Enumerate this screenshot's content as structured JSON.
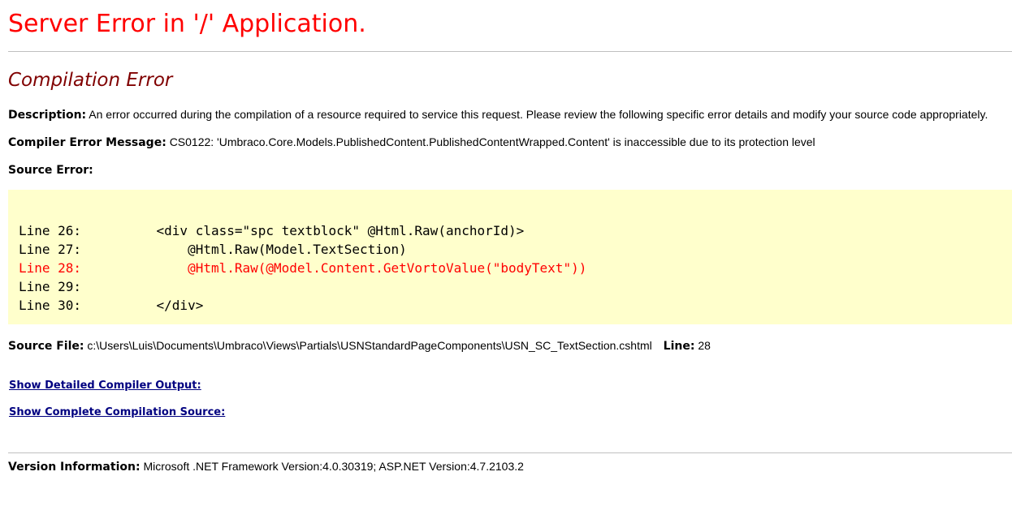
{
  "header": {
    "title": "Server Error in '/' Application.",
    "subtitle": "Compilation Error"
  },
  "description": {
    "label": "Description:",
    "text": "An error occurred during the compilation of a resource required to service this request. Please review the following specific error details and modify your source code appropriately."
  },
  "compiler_error": {
    "label": "Compiler Error Message:",
    "text": "CS0122: 'Umbraco.Core.Models.PublishedContent.PublishedContentWrapped.Content' is inaccessible due to its protection level"
  },
  "source_error": {
    "label": "Source Error:",
    "lines": [
      {
        "num": "Line 26:",
        "code": "    <div class=\"spc textblock\" @Html.Raw(anchorId)>"
      },
      {
        "num": "Line 27:",
        "code": "        @Html.Raw(Model.TextSection)"
      },
      {
        "num": "Line 28:",
        "code": "        @Html.Raw(@Model.Content.GetVortoValue(\"bodyText\"))"
      },
      {
        "num": "Line 29:",
        "code": ""
      },
      {
        "num": "Line 30:",
        "code": "    </div>"
      }
    ]
  },
  "source_file": {
    "label": "Source File:",
    "path": "c:\\Users\\Luis\\Documents\\Umbraco\\Views\\Partials\\USNStandardPageComponents\\USN_SC_TextSection.cshtml",
    "line_label": "Line:",
    "line_value": "28"
  },
  "links": {
    "detailed_output": "Show Detailed Compiler Output:",
    "complete_source": "Show Complete Compilation Source:"
  },
  "version": {
    "label": "Version Information:",
    "text": "Microsoft .NET Framework Version:4.0.30319; ASP.NET Version:4.7.2103.2"
  },
  "colors": {
    "title": "#ff0000",
    "subtitle": "#800000",
    "code_background": "#ffffcc",
    "error_line": "#ff0000",
    "link": "#000080"
  }
}
